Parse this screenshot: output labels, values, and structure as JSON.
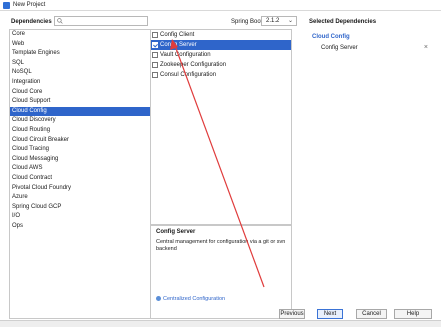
{
  "window": {
    "title": "New Project"
  },
  "header": {
    "dependencies_label": "Dependencies",
    "search_placeholder": "",
    "spring_boot_label": "Spring Boot",
    "spring_boot_version": "2.1.2",
    "selected_dependencies_title": "Selected Dependencies"
  },
  "left_list": {
    "items": [
      "Core",
      "Web",
      "Template Engines",
      "SQL",
      "NoSQL",
      "Integration",
      "Cloud Core",
      "Cloud Support",
      "Cloud Config",
      "Cloud Discovery",
      "Cloud Routing",
      "Cloud Circuit Breaker",
      "Cloud Tracing",
      "Cloud Messaging",
      "Cloud AWS",
      "Cloud Contract",
      "Pivotal Cloud Foundry",
      "Azure",
      "Spring Cloud GCP",
      "I/O",
      "Ops"
    ],
    "selected_index": 8
  },
  "middle_list": {
    "items": [
      {
        "label": "Config Client",
        "checked": false
      },
      {
        "label": "Config Server",
        "checked": true
      },
      {
        "label": "Vault Configuration",
        "checked": false
      },
      {
        "label": "Zookeeper Configuration",
        "checked": false
      },
      {
        "label": "Consul Configuration",
        "checked": false
      }
    ],
    "selected_index": 1
  },
  "description": {
    "title": "Config Server",
    "text": "Central management for configuration via a git or svn backend",
    "reference_link": "Centralized Configuration"
  },
  "selected_dependencies": {
    "group": "Cloud Config",
    "items": [
      "Config Server"
    ]
  },
  "buttons": {
    "previous": "Previous",
    "next": "Next",
    "cancel": "Cancel",
    "help": "Help"
  },
  "colors": {
    "selection": "#2f65ca",
    "annotation_arrow": "#e03c3c"
  },
  "icons": {
    "app": "intellij-icon",
    "search": "search-icon",
    "dropdown": "chevron-down-icon",
    "remove": "close-icon",
    "reference": "reference-link-icon"
  }
}
